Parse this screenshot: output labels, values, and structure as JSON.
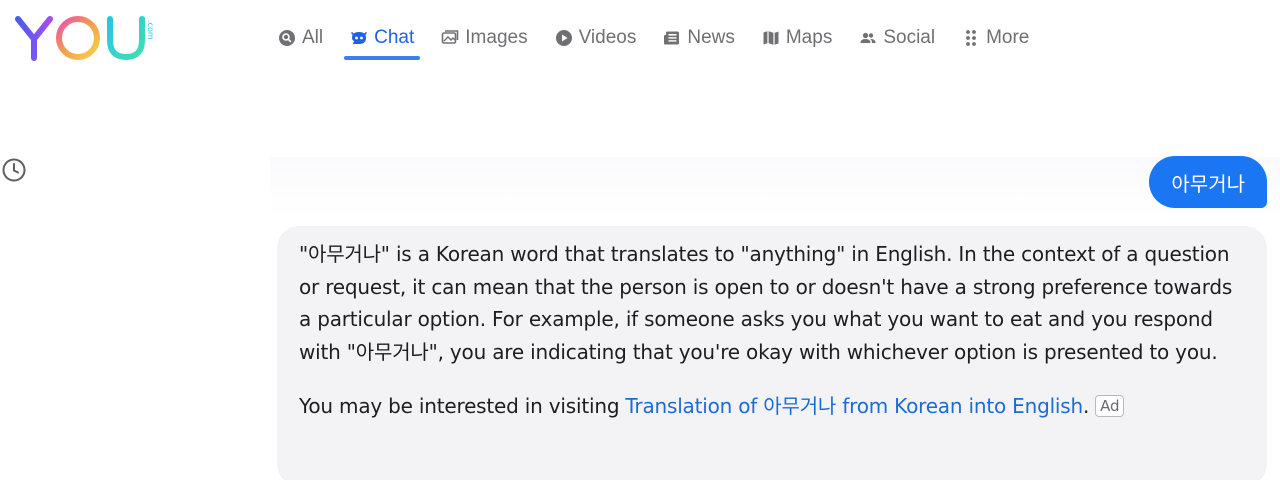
{
  "logo": {
    "text": "YOU",
    "suffix": ".com"
  },
  "nav": {
    "items": [
      {
        "label": "All",
        "icon": "search-circle-icon",
        "active": false
      },
      {
        "label": "Chat",
        "icon": "chat-bot-icon",
        "active": true
      },
      {
        "label": "Images",
        "icon": "images-icon",
        "active": false
      },
      {
        "label": "Videos",
        "icon": "play-circle-icon",
        "active": false
      },
      {
        "label": "News",
        "icon": "newspaper-icon",
        "active": false
      },
      {
        "label": "Maps",
        "icon": "map-icon",
        "active": false
      },
      {
        "label": "Social",
        "icon": "people-icon",
        "active": false
      },
      {
        "label": "More",
        "icon": "grid-dots-icon",
        "active": false
      }
    ]
  },
  "history": {
    "icon": "clock-icon"
  },
  "chat": {
    "user_message": "아무거나",
    "answer": "\"아무거나\" is a Korean word that translates to \"anything\" in English. In the context of a question or request, it can mean that the person is open to or doesn't have a strong preference towards a particular option. For example, if someone asks you what you want to eat and you respond with \"아무거나\", you are indicating that you're okay with whichever option is presented to you.",
    "ad": {
      "prefix": "You may be interested in visiting",
      "link_text": "Translation of 아무거나 from Korean into English",
      "suffix": ".",
      "badge": "Ad"
    }
  },
  "colors": {
    "accent": "#2063e0",
    "user_bubble": "#1a76f2",
    "card_bg": "#f3f3f6",
    "link": "#1a6cd6"
  }
}
